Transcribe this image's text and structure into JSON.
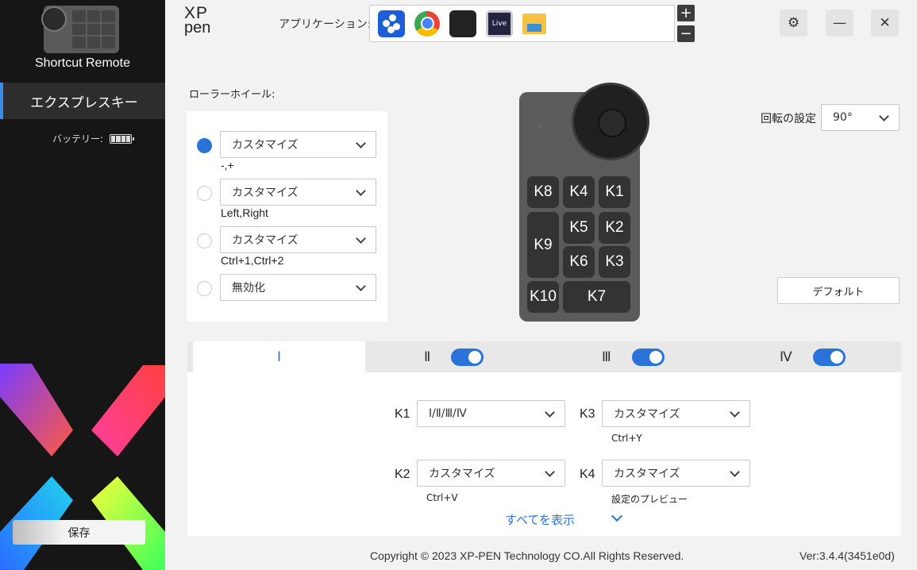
{
  "sidebar": {
    "device_name": "Shortcut Remote",
    "nav_item": "エクスプレスキー",
    "battery_label": "バッテリー:",
    "save_label": "保存"
  },
  "topbar": {
    "logo_top": "XP",
    "logo_bottom": "pen",
    "app_label": "アプリケーション:",
    "apps": [
      "app-1-icon",
      "chrome-icon",
      "app-3-icon",
      "live-icon",
      "folder-icon"
    ],
    "live_text": "Live",
    "plus": "+",
    "minus": "−",
    "settings_icon": "⚙",
    "minimize_icon": "—",
    "close_icon": "✕"
  },
  "roller": {
    "title": "ローラーホイール:",
    "options": [
      {
        "value": "カスタマイズ",
        "sub": "-,+",
        "checked": true
      },
      {
        "value": "カスタマイズ",
        "sub": "Left,Right",
        "checked": false
      },
      {
        "value": "カスタマイズ",
        "sub": "Ctrl+1,Ctrl+2",
        "checked": false
      },
      {
        "value": "無効化",
        "sub": "",
        "checked": false
      }
    ]
  },
  "device": {
    "keys": [
      "K8",
      "K4",
      "K1",
      "K9",
      "K5",
      "K2",
      "K6",
      "K3",
      "K10",
      "K7"
    ]
  },
  "rotation": {
    "label": "回転の設定",
    "value": "90°"
  },
  "default_label": "デフォルト",
  "tabs": {
    "labels": [
      "Ⅰ",
      "Ⅱ",
      "Ⅲ",
      "Ⅳ"
    ],
    "active": 0
  },
  "key_settings": {
    "k1": {
      "label": "K1",
      "value": "Ⅰ/Ⅱ/Ⅲ/Ⅳ",
      "sub": ""
    },
    "k3": {
      "label": "K3",
      "value": "カスタマイズ",
      "sub": "Ctrl+Y"
    },
    "k2": {
      "label": "K2",
      "value": "カスタマイズ",
      "sub": "Ctrl+V"
    },
    "k4": {
      "label": "K4",
      "value": "カスタマイズ",
      "sub": "設定のプレビュー"
    }
  },
  "show_all": "すべてを表示",
  "footer": {
    "copyright": "Copyright © 2023  XP-PEN Technology CO.All Rights Reserved.",
    "version": "Ver:3.4.4(3451e0d)"
  },
  "colors": {
    "accent": "#2a74d9",
    "sidebar_bg": "#161616"
  }
}
